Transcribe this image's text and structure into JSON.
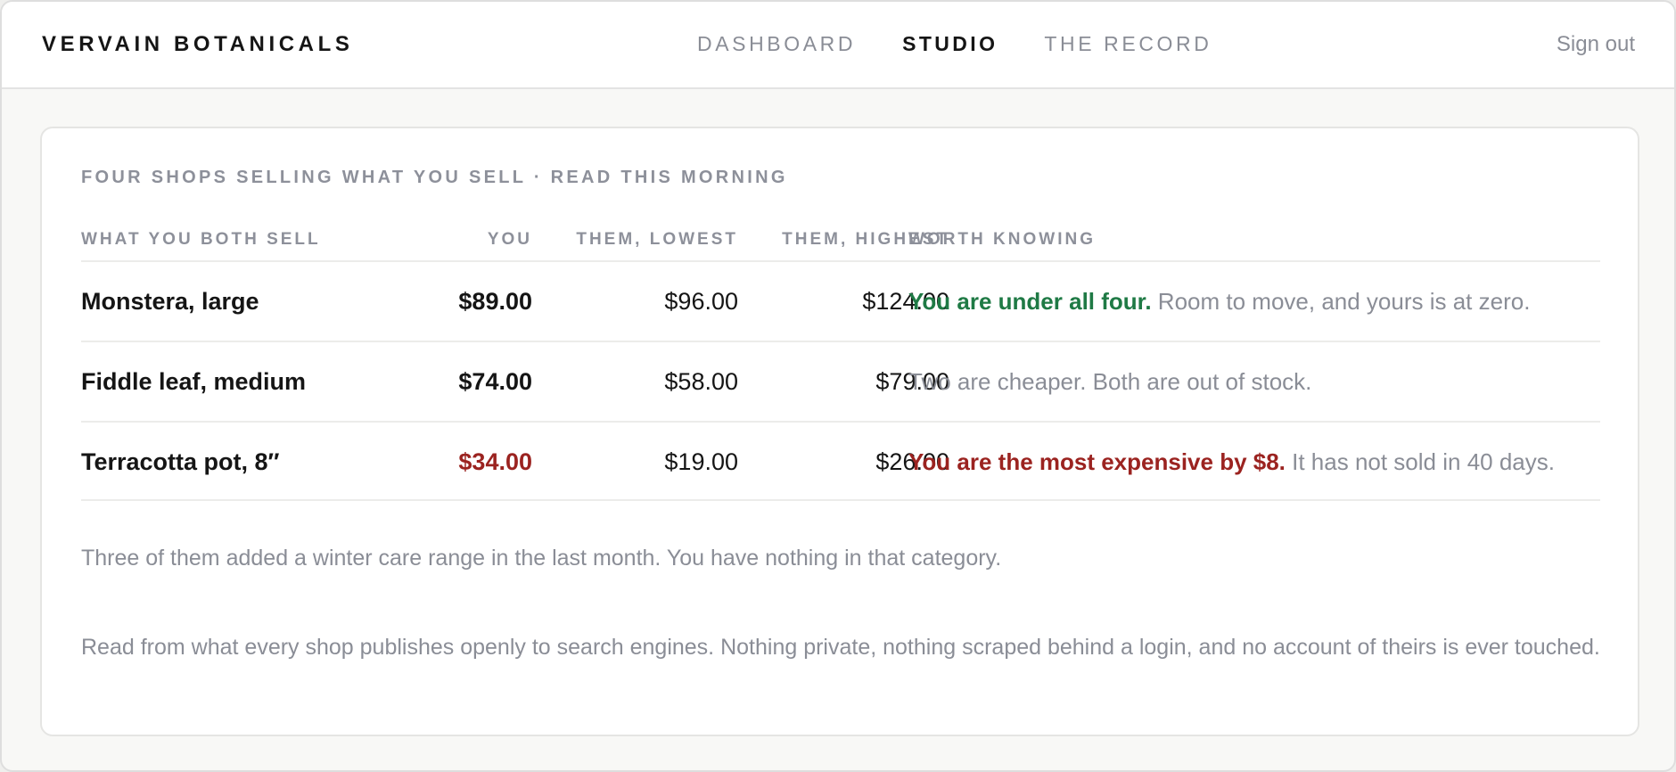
{
  "header": {
    "brand": "VERVAIN BOTANICALS",
    "nav": [
      {
        "label": "DASHBOARD",
        "active": false
      },
      {
        "label": "STUDIO",
        "active": true
      },
      {
        "label": "THE RECORD",
        "active": false
      }
    ],
    "sign_out": "Sign out"
  },
  "card": {
    "eyebrow": "FOUR SHOPS SELLING WHAT YOU SELL · READ THIS MORNING",
    "columns": [
      "WHAT YOU BOTH SELL",
      "YOU",
      "THEM, LOWEST",
      "THEM, HIGHEST",
      "WORTH KNOWING"
    ],
    "rows": [
      {
        "item": "Monstera, large",
        "you": "$89.00",
        "lowest": "$96.00",
        "highest": "$124.00",
        "note_strong": "You are under all four.",
        "note_rest": " Room to move, and yours is at zero."
      },
      {
        "item": "Fiddle leaf, medium",
        "you": "$74.00",
        "lowest": "$58.00",
        "highest": "$79.00",
        "note_strong": "",
        "note_rest": "Two are cheaper. Both are out of stock."
      },
      {
        "item": "Terracotta pot, 8″",
        "you": "$34.00",
        "lowest": "$19.00",
        "highest": "$26.00",
        "note_strong": "You are the most expensive by $8.",
        "note_rest": " It has not sold in 40 days."
      }
    ],
    "insight": "Three of them added a winter care range in the last month. You have nothing in that category.",
    "disclaimer": "Read from what every shop publishes openly to search engines. Nothing private, nothing scraped behind a login, and no account of theirs is ever touched."
  },
  "colors": {
    "positive": "#1f7a45",
    "negative": "#9b2320",
    "muted": "#8a8d96",
    "text": "#151515"
  }
}
